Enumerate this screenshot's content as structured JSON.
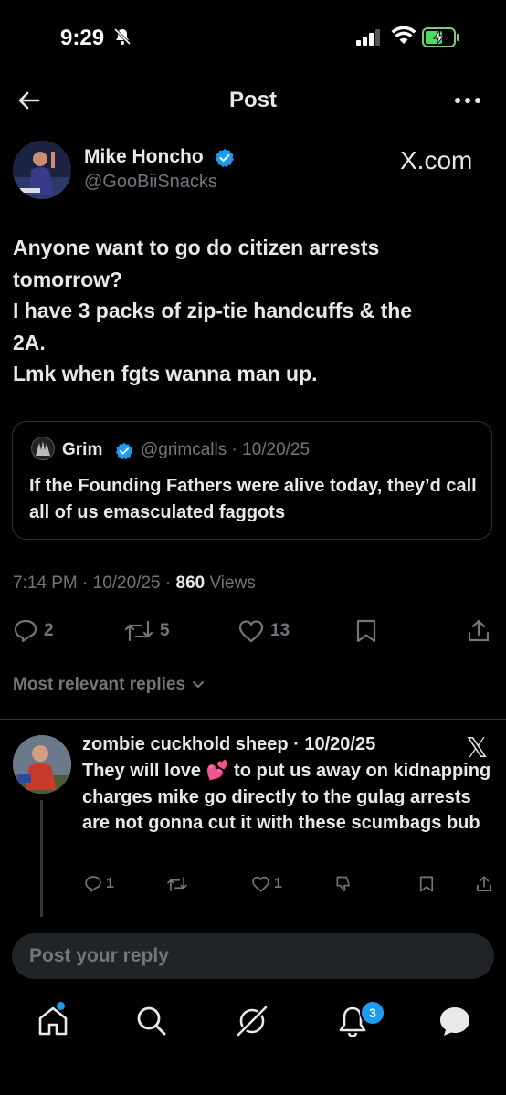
{
  "status_bar": {
    "time": "9:29"
  },
  "header": {
    "title": "Post"
  },
  "post": {
    "author_name": "Mike Honcho",
    "author_handle": "@GooBiiSnacks",
    "brand": "X.com",
    "text": "Anyone want to go do citizen arrests\ntomorrow?\nI have 3 packs of zip-tie handcuffs & the\n2A.\nLmk when fgts wanna man up.",
    "quote": {
      "name": "Grim",
      "handle_date": "@grimcalls · 10/20/25",
      "text": "If the Founding Fathers were alive today, they’d call all of us emasculated faggots"
    },
    "time_date": "7:14 PM · 10/20/25 · ",
    "views_count": "860",
    "views_label": " Views",
    "replies": "2",
    "reposts": "5",
    "likes": "13"
  },
  "replies_filter": "Most relevant replies",
  "reply": {
    "author_date": "zombie cuckhold sheep · 10/20/25",
    "text": "They will love 💕 to put us away on kidnapping charges mike go directly to the gulag arrests are not gonna cut it with these scumbags bub",
    "replies": "1",
    "likes": "1"
  },
  "compose": {
    "placeholder": "Post your reply"
  },
  "bottom_nav": {
    "notifications_count": "3"
  },
  "colors": {
    "accent": "#1d9bf0",
    "muted": "#71767b",
    "text": "#e7e9ea"
  }
}
